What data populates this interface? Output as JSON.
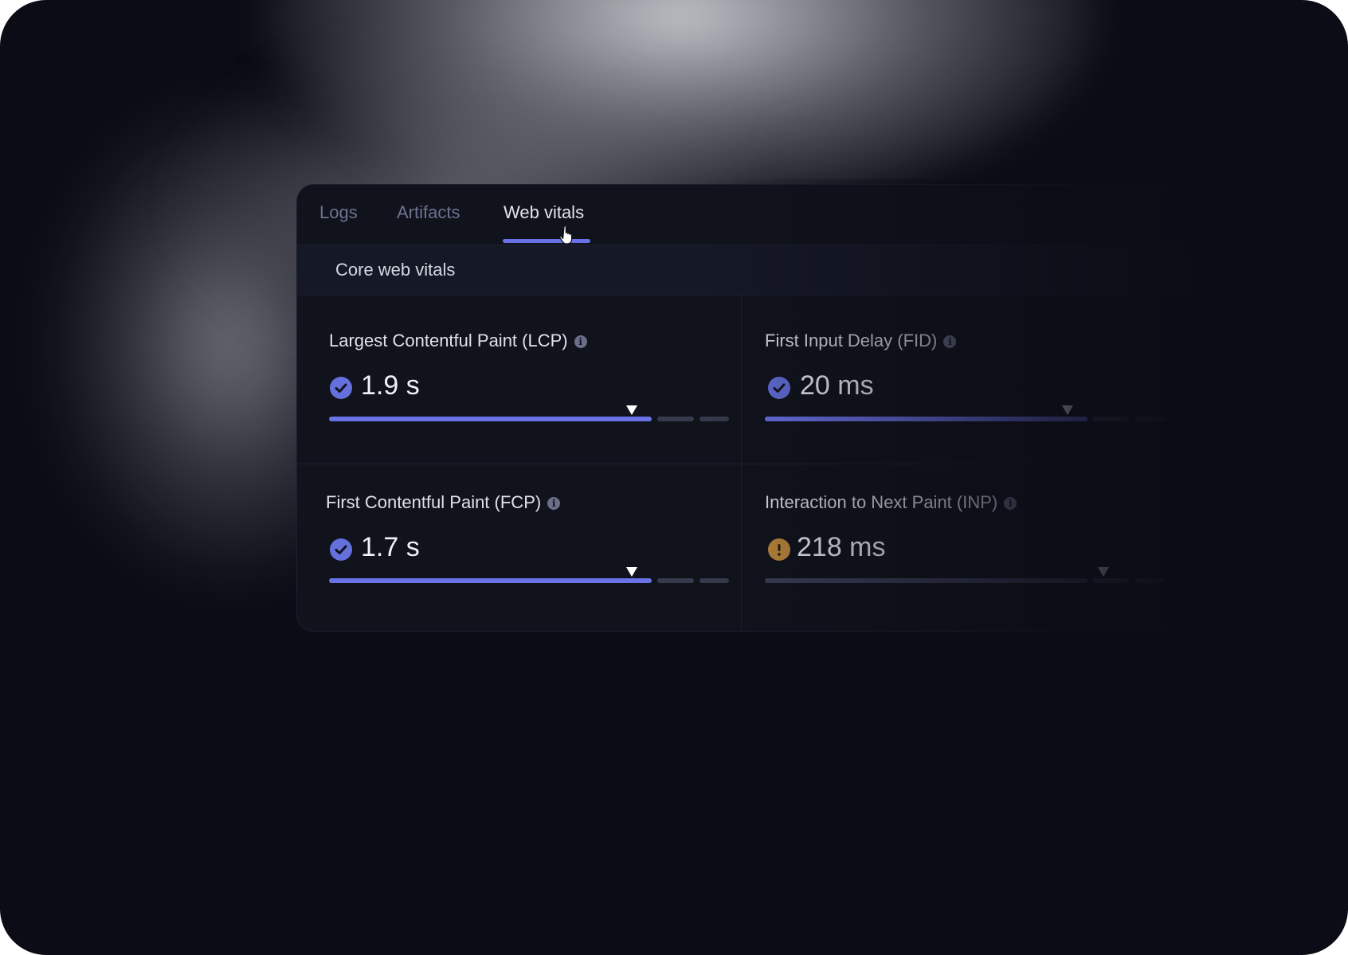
{
  "tabs": [
    {
      "label": "Logs",
      "active": false
    },
    {
      "label": "Artifacts",
      "active": false
    },
    {
      "label": "Web vitals",
      "active": true
    }
  ],
  "section": {
    "title": "Core web vitals"
  },
  "metrics": [
    {
      "title": "Largest Contentful Paint (LCP)",
      "value": "1.9 s",
      "status": "good",
      "marker_fraction": 0.76
    },
    {
      "title": "First Input Delay (FID)",
      "value": "20 ms",
      "status": "good",
      "marker_fraction": 0.76
    },
    {
      "title": "First Contentful Paint (FCP)",
      "value": "1.7 s",
      "status": "good",
      "marker_fraction": 0.76
    },
    {
      "title": "Interaction to Next Paint (INP)",
      "value": "218 ms",
      "status": "warning",
      "marker_fraction": 0.85
    }
  ],
  "colors": {
    "accent": "#6971e6",
    "good": "#6470dc",
    "warning": "#c08a3c",
    "background": "#0b0c15",
    "panel": "#10121c"
  },
  "icons": {
    "status_good": "check-circle-icon",
    "status_warning": "exclamation-circle-icon",
    "info": "info-icon",
    "cursor": "hand-pointer-icon"
  }
}
